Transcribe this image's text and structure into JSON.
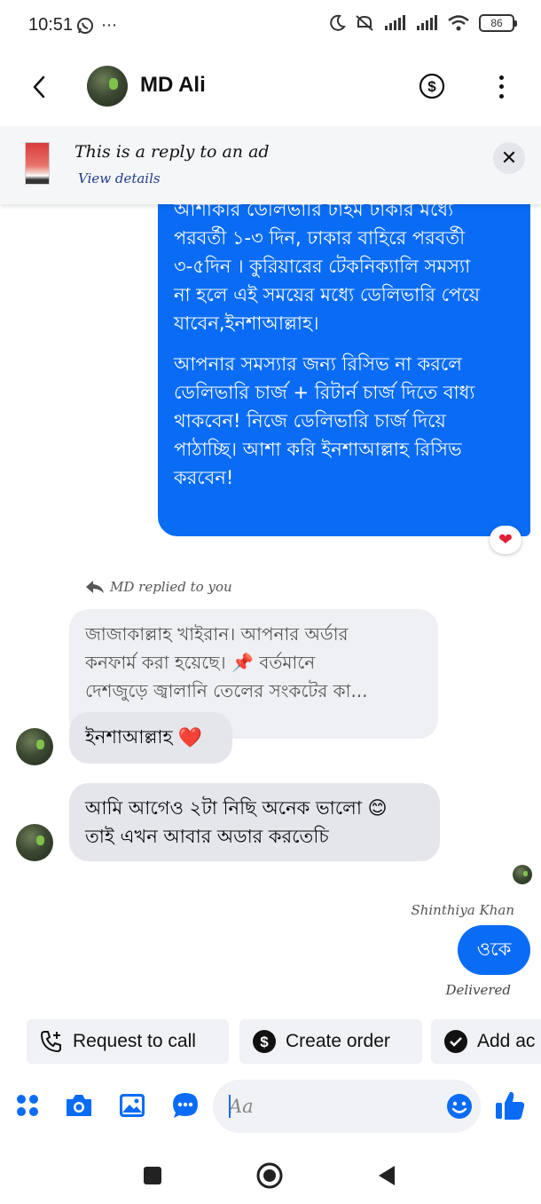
{
  "status_bar": {
    "time": "10:51",
    "overflow": "⋯",
    "battery": "86",
    "icons": [
      "whatsapp-icon",
      "moon-icon",
      "mute-icon",
      "signal-icon",
      "signal-icon",
      "wifi-icon",
      "battery-icon"
    ]
  },
  "header": {
    "contact_name": "MD Ali",
    "back_icon": "back-chevron-icon",
    "payment_icon": "dollar-circle-icon",
    "menu_icon": "more-vertical-icon"
  },
  "ad_banner": {
    "title": "This is a reply to an ad",
    "link": "View details",
    "close_label": "✕"
  },
  "messages": {
    "outgoing_long": {
      "lines": [
        "আশাকরি ডেলিভারি টাইম ঢাকার মধ্যে",
        "পরবর্তী ১-৩ দিন, ঢাকার বাহিরে পরবর্তী",
        "৩-৫দিন । কুরিয়ারের টেকনিক্যালি সমস্যা",
        "না হলে এই সময়ের মধ্যে ডেলিভারি পেয়ে",
        "যাবেন,ইনশাআল্লাহ।"
      ],
      "lines_2": [
        "আপনার সমস্যার জন্য রিসিভ না করলে",
        "ডেলিভারি চার্জ + রিটার্ন চার্জ দিতে বাধ্য",
        "থাকবেন!  নিজে ডেলিভারি চার্জ দিয়ে",
        "পাঠাচ্ছি। আশা করি ইনশাআল্লাহ রিসিভ",
        "করবেন!"
      ],
      "reaction": "❤"
    },
    "reply_context": "MD replied to you",
    "quoted": {
      "line1": "জাজাকাল্লাহ খাইরান। আপনার অর্ডার",
      "line2": "কনফার্ম করা হয়েছে। 📌 বর্তমানে",
      "line3": "দেশজুড়ে জ্বালানি তেলের সংকটের কা..."
    },
    "incoming_reply": {
      "text": "ইনশাআল্লাহ",
      "emoji": "❤️"
    },
    "incoming_2": {
      "line1": "আমি আগেও ২টা নিছি অনেক ভালো 😊",
      "line2": "তাই এখন আবার অডার করতেচি"
    },
    "sender_name": "Shinthiya Khan",
    "outgoing_short": "ওকে",
    "delivery_status": "Delivered"
  },
  "quick_actions": [
    {
      "label": "Request to call",
      "icon": "phone-plus-icon"
    },
    {
      "label": "Create order",
      "icon": "dollar-circle-icon"
    },
    {
      "label": "Add ac",
      "icon": "check-circle-icon"
    }
  ],
  "composer": {
    "placeholder": "Aa",
    "value": "",
    "icons": [
      "apps-grid-icon",
      "camera-icon",
      "gallery-icon",
      "chat-bubble-icon",
      "emoji-icon",
      "thumbs-up-icon"
    ]
  },
  "nav_bar": {
    "icons": [
      "recents-square-icon",
      "home-circle-icon",
      "back-triangle-icon"
    ]
  },
  "colors": {
    "accent": "#0a6cf5",
    "incoming_bubble": "#e4e6eb",
    "quoted_bubble": "#eef0f3",
    "heart": "#e0213a"
  }
}
